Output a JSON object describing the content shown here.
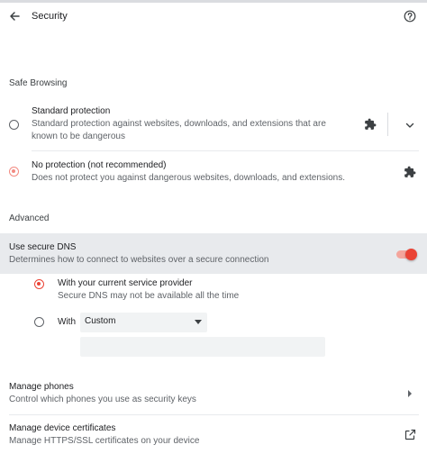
{
  "header": {
    "title": "Security",
    "back_icon": "arrow-back-icon",
    "help_icon": "help-circle-icon"
  },
  "safe_browsing": {
    "section_label": "Safe Browsing",
    "standard": {
      "title": "Standard protection",
      "description_line1": "Standard protection against websites, downloads, and extensions that are",
      "description_line2": "known to be dangerous",
      "selected": false,
      "icon": "puzzle-extension-icon"
    },
    "no_protection": {
      "title": "No protection (not recommended)",
      "description": "Does not protect you against dangerous websites, downloads, and extensions.",
      "selected": true,
      "icon": "puzzle-extension-icon"
    }
  },
  "advanced": {
    "section_label": "Advanced",
    "secure_dns": {
      "title": "Use secure DNS",
      "description": "Determines how to connect to websites over a secure connection",
      "enabled": true,
      "options": {
        "current_provider": {
          "title": "With your current service provider",
          "description": "Secure DNS may not be available all the time",
          "selected": true
        },
        "custom": {
          "label": "With",
          "selected": false,
          "select_value": "Custom",
          "input_value": ""
        }
      }
    },
    "manage_phones": {
      "title": "Manage phones",
      "description": "Control which phones you use as security keys"
    },
    "manage_certificates": {
      "title": "Manage device certificates",
      "description": "Manage HTTPS/SSL certificates on your device",
      "icon": "open-in-new-icon"
    }
  },
  "colors": {
    "accent": "#ea4335",
    "accent_light": "#f28b82",
    "highlight_row": "#e8eaed"
  }
}
